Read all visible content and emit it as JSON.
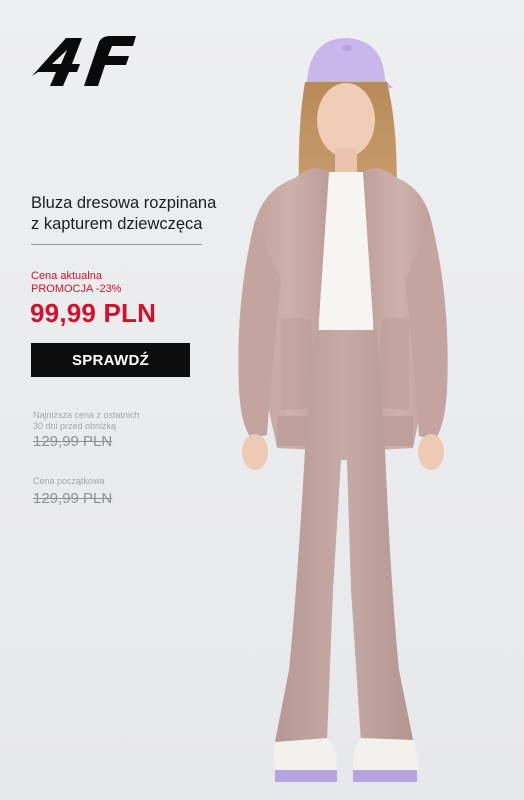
{
  "brand": {
    "logo_text": "4F",
    "logo_icon": "4f-logo"
  },
  "product": {
    "title_line1": "Bluza dresowa rozpinana",
    "title_line2": "z kapturem dziewczęca",
    "price_label_line1": "Cena aktualna",
    "price_label_line2": "PROMOCJA -23%",
    "current_price": "99,99 PLN",
    "cta_label": "SPRAWDŹ",
    "lowest_label_line1": "Najniższa cena z ostatnich",
    "lowest_label_line2": "30 dni przed obniżką",
    "lowest_price": "129,99 PLN",
    "start_label": "Cena początkowa",
    "start_price": "129,99 PLN"
  },
  "colors": {
    "accent_red": "#d4112c",
    "button_bg": "#0d0d0d",
    "product_color": "#c9aaa6"
  }
}
